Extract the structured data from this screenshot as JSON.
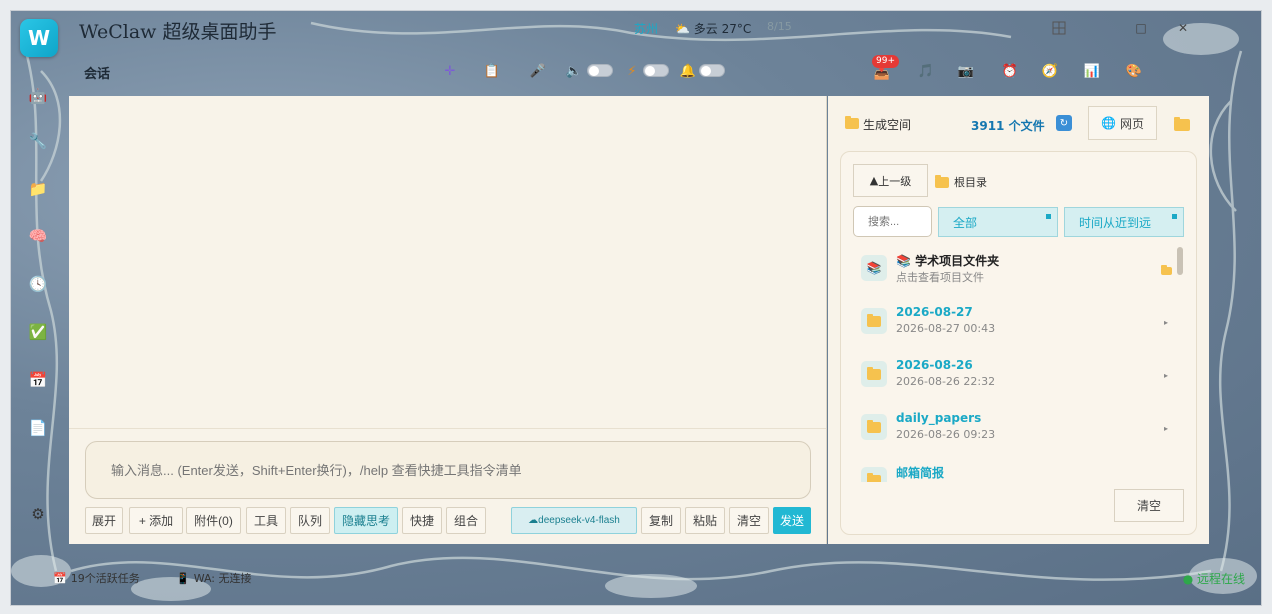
{
  "app": {
    "logo_letter": "W",
    "title": "WeClaw 超级桌面助手",
    "city": "苏州",
    "weather": "多云 27°C",
    "weather_extra": "8/15"
  },
  "titlebar": {
    "grid_icon": "grid-icon",
    "minimize": "□",
    "close": "✕"
  },
  "section": {
    "label": "会话"
  },
  "toolbar": {
    "badge": "99+"
  },
  "input": {
    "placeholder": "输入消息... (Enter发送，Shift+Enter换行)，/help 查看快捷工具指令清单"
  },
  "buttons": {
    "expand": "展开",
    "add": "+ 添加",
    "attach": "附件(0)",
    "tools": "工具",
    "queue": "队列",
    "hide_think": "隐藏思考",
    "quick": "快捷",
    "combo": "组合",
    "model": "deepseek-v4-flash",
    "copy": "复制",
    "paste": "粘贴",
    "clear": "清空",
    "send": "发送"
  },
  "side": {
    "label": "生成空间",
    "count": "3911 个文件",
    "web": "网页",
    "up": "上一级",
    "root": "根目录",
    "search_placeholder": "搜索...",
    "filter_all": "全部",
    "filter_sort": "时间从近到远",
    "clear": "清空",
    "items": [
      {
        "name": "学术项目文件夹",
        "sub": "点击查看项目文件"
      },
      {
        "name": "2026-08-27",
        "sub": "2026-08-27 00:43"
      },
      {
        "name": "2026-08-26",
        "sub": "2026-08-26 22:32"
      },
      {
        "name": "daily_papers",
        "sub": "2026-08-26 09:23"
      },
      {
        "name": "邮箱简报",
        "sub": ""
      }
    ]
  },
  "status": {
    "active": "19个活跃任务",
    "wa": "WA: 无连接",
    "online": "● 远程在线"
  },
  "colors": {
    "accent": "#22b8d3",
    "badge": "#e53935",
    "count": "#1577b0"
  }
}
